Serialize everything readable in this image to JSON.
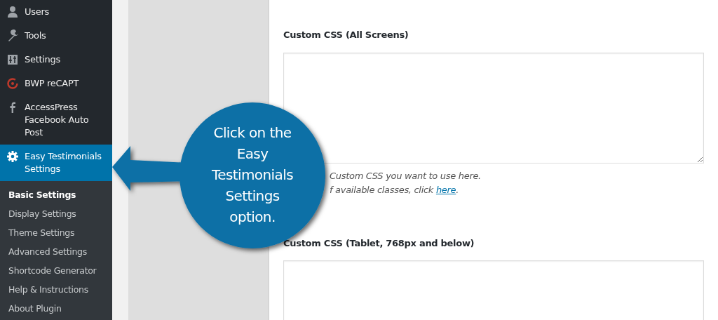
{
  "sidebar": {
    "items": [
      {
        "label": "Users",
        "selected": false
      },
      {
        "label": "Tools",
        "selected": false
      },
      {
        "label": "Settings",
        "selected": false
      },
      {
        "label": "BWP reCAPT",
        "selected": false
      },
      {
        "label": "AccessPress Facebook Auto Post",
        "selected": false
      },
      {
        "label": "Easy Testimonials Settings",
        "selected": true
      }
    ],
    "submenu": [
      {
        "label": "Basic Settings",
        "selected": true
      },
      {
        "label": "Display Settings",
        "selected": false
      },
      {
        "label": "Theme Settings",
        "selected": false
      },
      {
        "label": "Advanced Settings",
        "selected": false
      },
      {
        "label": "Shortcode Generator",
        "selected": false
      },
      {
        "label": "Help & Instructions",
        "selected": false
      },
      {
        "label": "About Plugin",
        "selected": false
      }
    ]
  },
  "fields": [
    {
      "label": "Custom CSS (All Screens)",
      "help": [
        "Custom CSS you want to use here.",
        "f available classes, click "
      ],
      "help_link": "here",
      "help_end": "."
    },
    {
      "label": "Custom CSS (Tablet, 768px and below)"
    }
  ],
  "callout": {
    "text": "Click on the Easy Testimonials Settings option."
  }
}
